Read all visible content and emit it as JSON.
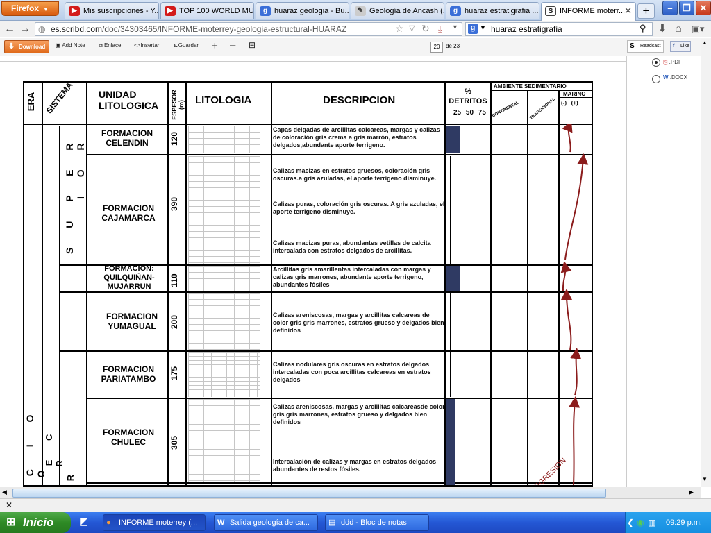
{
  "browser": {
    "menu_button": "Firefox",
    "tabs": [
      {
        "label": "Mis suscripciones - Y...",
        "icon": "youtube-icon"
      },
      {
        "label": "TOP 100 WORLD MU...",
        "icon": "youtube-icon"
      },
      {
        "label": "huaraz geologia - Bu...",
        "icon": "google-icon"
      },
      {
        "label": "Geología de Ancash (...",
        "icon": "page-icon"
      },
      {
        "label": "huaraz estratigrafia ...",
        "icon": "google-icon"
      },
      {
        "label": "INFORME moterr...",
        "icon": "scribd-icon",
        "active": true
      }
    ],
    "url_host": "es.scribd.com",
    "url_path": "/doc/34303465/INFORME-moterrey-geologia-estructural-HUARAZ",
    "search_query": "huaraz estratigrafia"
  },
  "scribd_toolbar": {
    "download": "Download",
    "add_note": "Add Note",
    "link": "Enlace",
    "embed": "Insertar",
    "save": "Guardar",
    "page_current": "20",
    "page_total": "de 23",
    "readcast": "Readcast",
    "like": "Like"
  },
  "side_panel": {
    "formats": [
      ".PDF",
      ".DOCX"
    ]
  },
  "table": {
    "headers": {
      "era": "ERA",
      "sistema": "SISTEMA",
      "unidad": "UNIDAD LITOLOGICA",
      "espesor": "ESPESOR (m)",
      "litologia": "LITOLOGIA",
      "descripcion": "DESCRIPCION",
      "detritos": "% DETRITOS",
      "detritos_scale": "25 50 75",
      "ambiente": "AMBIENTE SEDIMENTARIO",
      "continental": "CONTINENTAL",
      "transicional": "TRANSICIONAL",
      "marino": "MARINO",
      "marino_scale": "(-)   (+)"
    },
    "era_letters": "O C I O Z O",
    "sistema_letters": "O E C A R",
    "serie_letters": "S U P E R I O R",
    "serie_lower": "R",
    "regresion": "REGRESION",
    "formations": [
      {
        "name": "FORMACION CELENDIN",
        "thickness": "120",
        "detritos": 15,
        "desc": [
          "Capas delgadas de arcillitas calcareas, margas y calizas de coloración gris crema a gris marrón, estratos delgados,abundante aporte terrigeno."
        ]
      },
      {
        "name": "FORMACION CAJAMARCA",
        "thickness": "390",
        "detritos": 0,
        "desc": [
          "Calizas macizas en estratos gruesos, coloración gris oscuras.a gris azuladas, el aporte terrigeno disminuye.",
          "Calizas puras, coloración gris oscuras. A gris azuladas, el aporte terrigeno disminuye.",
          "Calizas macizas puras, abundantes vetillas de calcita intercalada con estratos delgados de arcillitas."
        ]
      },
      {
        "name": "FORMACION: QUILQUIÑAN-MUJARRUN",
        "thickness": "110",
        "detritos": 15,
        "desc": [
          "Arcillitas gris amarillentas intercaladas con margas y calizas gris marrones, abundante aporte terrigeno, abundantes fósiles"
        ]
      },
      {
        "name": "FORMACION YUMAGUAL",
        "thickness": "200",
        "detritos": 0,
        "desc": [
          "Calizas areniscosas, margas y arcillitas calcareas de color gris gris marrones, estratos grueso y delgados bien definidos"
        ]
      },
      {
        "name": "FORMACION PARIATAMBO",
        "thickness": "175",
        "detritos": 0,
        "desc": [
          "Calizas nodulares gris oscuras en estratos delgados intercaladas con poca arcillitas calcareas en estratos delgados"
        ]
      },
      {
        "name": "FORMACION CHULEC",
        "thickness": "305",
        "detritos": 10,
        "desc": [
          "Calizas areniscosas, margas y arcillitas calcareasde color gris gris marrones, estratos grueso y delgados bien definidos",
          "Intercalación de calizas y margas en estratos delgados abundantes de restos fósiles."
        ]
      }
    ]
  },
  "taskbar": {
    "start": "Inicio",
    "tasks": [
      "INFORME moterrey (...",
      "Salida geología de ca...",
      "ddd - Bloc de notas"
    ],
    "clock": "09:29 p.m."
  },
  "colors": {
    "taskbar": "#2457d4",
    "start": "#2e8a25",
    "firefox": "#e06a1b",
    "detritos_bar": "#2f3a63",
    "arrow": "#8b1c1c"
  }
}
